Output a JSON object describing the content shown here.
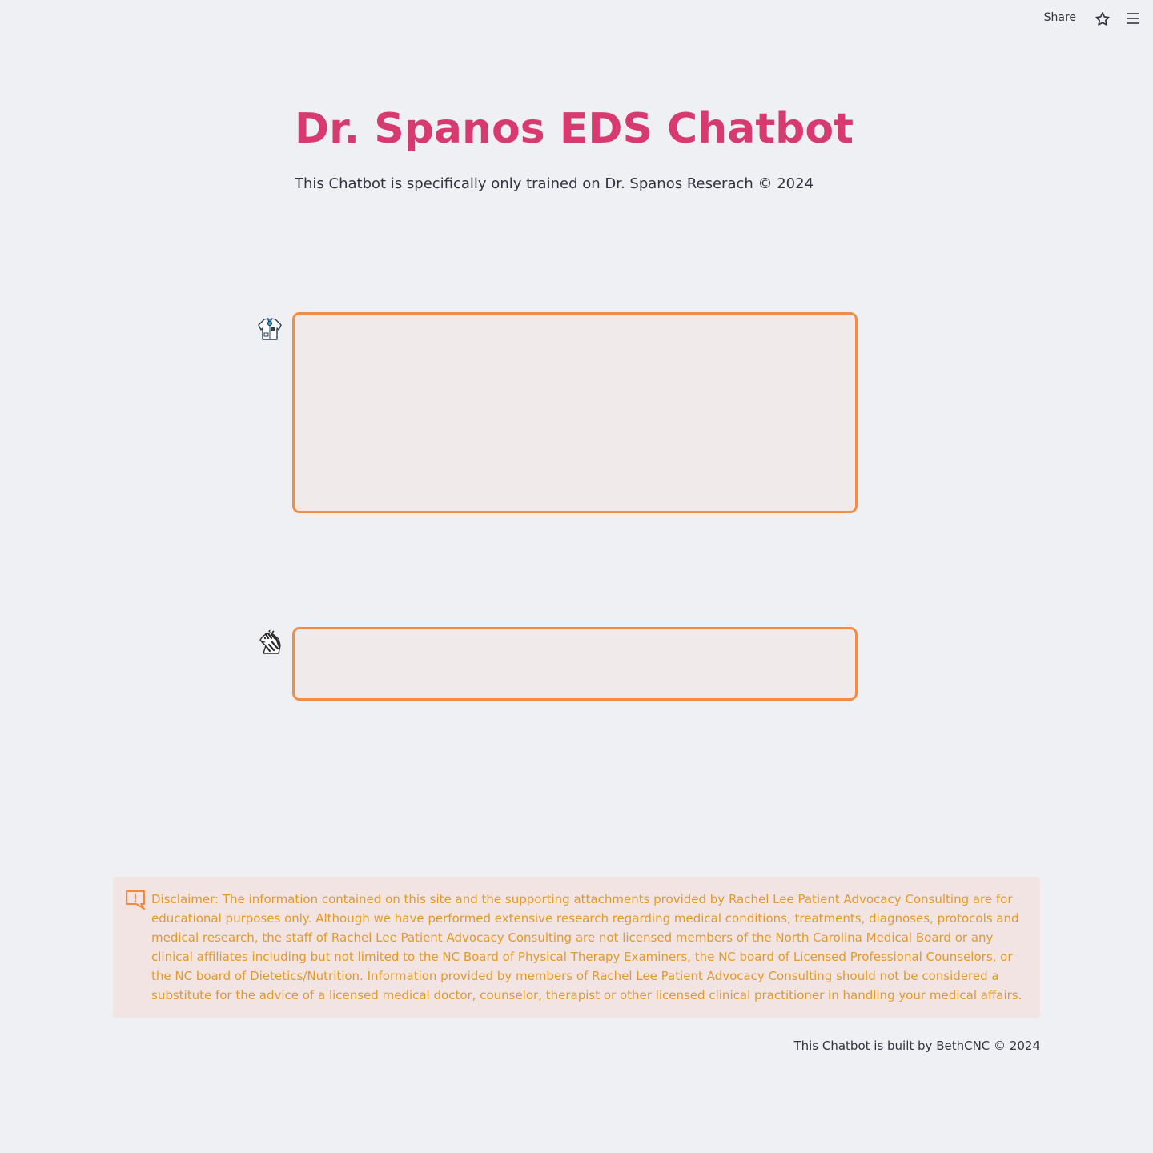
{
  "topbar": {
    "share_label": "Share",
    "icons": [
      "star-icon",
      "hamburger-menu-icon"
    ]
  },
  "header": {
    "title": "Dr. Spanos EDS Chatbot",
    "subtitle": "This Chatbot is specifically only trained on Dr. Spanos Reserach © 2024"
  },
  "chat": {
    "messages": [
      {
        "role": "assistant",
        "avatar": "doctor-coat-icon",
        "text": ""
      },
      {
        "role": "user",
        "avatar": "zebra-icon",
        "text": ""
      }
    ]
  },
  "disclaimer": {
    "icon": "warning-icon",
    "text": "Disclaimer: The information contained on this site and the supporting attachments provided by Rachel Lee Patient Advocacy Consulting are for educational purposes only. Although we have performed extensive research regarding medical conditions, treatments, diagnoses, protocols and medical research, the staff of Rachel Lee Patient Advocacy Consulting are not licensed members of the North Carolina Medical Board or any clinical affiliates including but not limited to the NC Board of Physical Therapy Examiners, the NC board of Licensed Professional Counselors, or the NC board of Dietetics/Nutrition. Information provided by members of Rachel Lee Patient Advocacy Consulting should not be considered a substitute for the advice of a licensed medical doctor, counselor, therapist or other licensed clinical practitioner in handling your medical affairs."
  },
  "footer": {
    "text": "This Chatbot is built by BethCNC © 2024"
  },
  "colors": {
    "accent_title": "#d63a6e",
    "box_border": "#f58c45",
    "disclaimer_text": "#e29a2b",
    "background": "#eff0f4"
  }
}
